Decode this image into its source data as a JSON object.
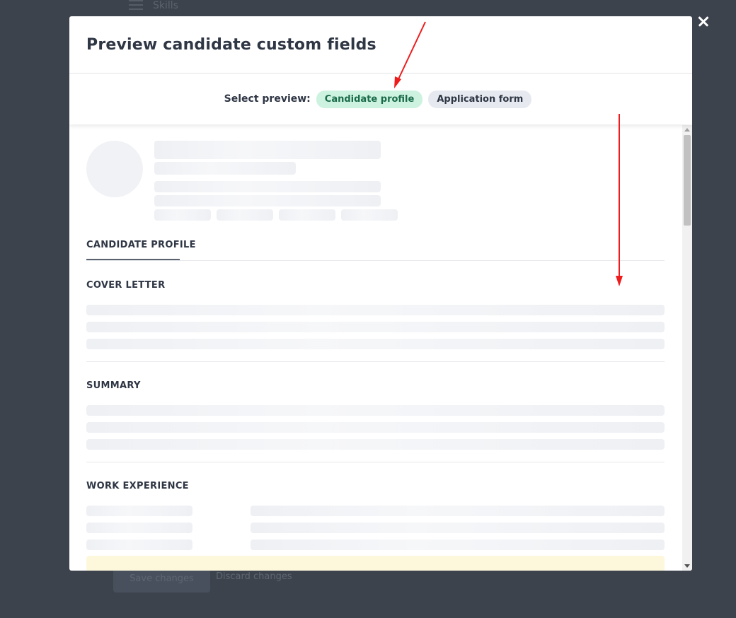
{
  "background": {
    "menu_label": "Skills",
    "save_button": "Save changes",
    "discard_link": "Discard changes"
  },
  "modal": {
    "title": "Preview candidate custom fields",
    "select_preview_label": "Select preview:",
    "tabs": [
      {
        "label": "Candidate profile",
        "active": true
      },
      {
        "label": "Application form",
        "active": false
      }
    ]
  },
  "profile": {
    "tab_label": "CANDIDATE PROFILE",
    "sections": [
      {
        "title": "COVER LETTER"
      },
      {
        "title": "SUMMARY"
      },
      {
        "title": "WORK EXPERIENCE"
      }
    ]
  },
  "colors": {
    "overlay": "#3d434d",
    "active_pill_bg": "#cdf2e0",
    "active_pill_text": "#1a6b4a",
    "annotation_arrow": "#ee1c1c"
  }
}
